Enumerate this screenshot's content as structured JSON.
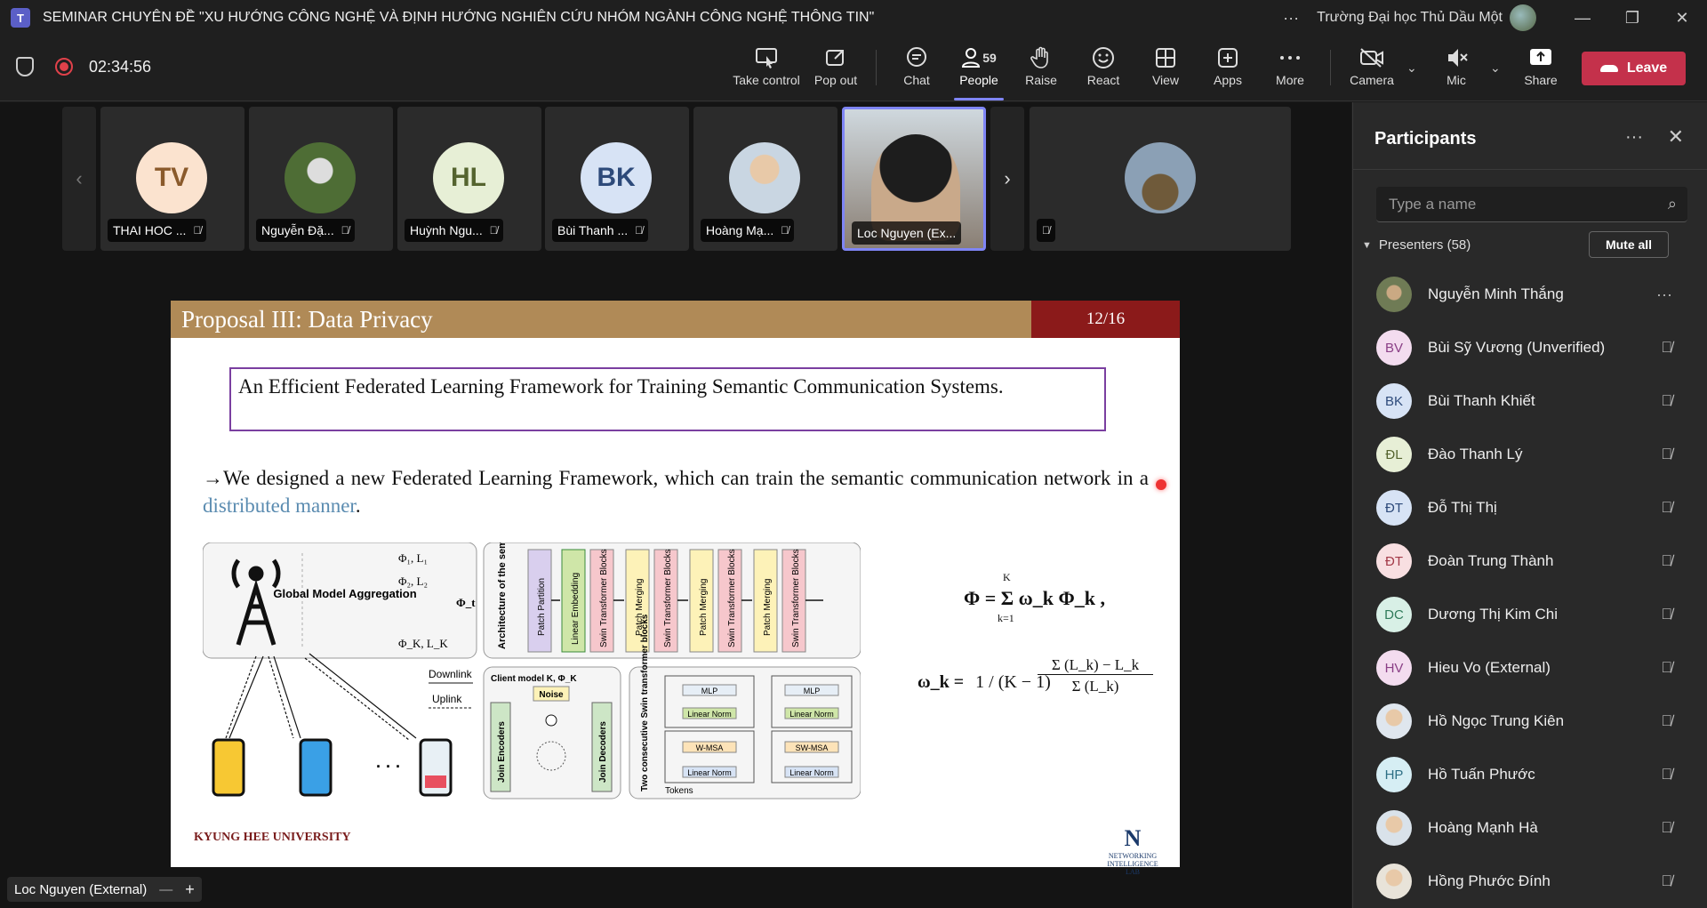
{
  "window": {
    "app_icon_letter": "T",
    "title": "SEMINAR CHUYÊN ĐỀ \"XU HƯỚNG CÔNG NGHỆ VÀ ĐỊNH HƯỚNG NGHIÊN CỨU NHÓM NGÀNH CÔNG NGHỆ THÔNG TIN\"",
    "more": "···",
    "org": "Trường Đại học Thủ Dầu Một",
    "minimize": "—",
    "restore": "❐",
    "close": "✕"
  },
  "toolbar": {
    "timer": "02:34:56",
    "take_control": "Take control",
    "pop_out": "Pop out",
    "chat": "Chat",
    "people": "People",
    "people_count": "59",
    "raise": "Raise",
    "react": "React",
    "view": "View",
    "apps": "Apps",
    "more": "More",
    "camera": "Camera",
    "mic": "Mic",
    "share": "Share",
    "leave": "Leave"
  },
  "strip": {
    "prev": "‹",
    "next": "›",
    "tiles": [
      {
        "initials": "TV",
        "name": "THAI HOC ...",
        "bg": "#fbe3cf",
        "fg": "#8a5a2b"
      },
      {
        "initials": "",
        "name": "Nguyễn Đặ...",
        "bg": "#6d8a4a",
        "fg": "#fff"
      },
      {
        "initials": "HL",
        "name": "Huỳnh Ngu...",
        "bg": "#e7efd6",
        "fg": "#55642f"
      },
      {
        "initials": "BK",
        "name": "Bùi Thanh ...",
        "bg": "#d7e3f5",
        "fg": "#2d4a7a"
      },
      {
        "initials": "",
        "name": "Hoàng Mạ...",
        "bg": "#d9e2ea",
        "fg": "#333"
      },
      {
        "initials": "",
        "name": "Loc Nguyen (Ex...",
        "bg": "#d6dde3",
        "fg": "#333"
      },
      {
        "initials": "",
        "name": "",
        "bg": "#8c7a5a",
        "fg": "#fff"
      }
    ]
  },
  "slide": {
    "title": "Proposal III: Data Privacy",
    "page": "12/16",
    "boxed_text": "An Efficient Federated Learning Framework for Training Semantic Communication Systems.",
    "bullet_prefix": "→We designed a new Federated Learning Framework, which can train the semantic communication network in a ",
    "bullet_highlight": "distributed manner",
    "bullet_suffix": ".",
    "fig": {
      "global": "Global Model Aggregation",
      "phi1": "Φ₁, L₁",
      "phi2": "Φ₂, L₂",
      "phiK": "Φ_K, L_K",
      "phit": "Φ_t",
      "downlink": "Downlink",
      "uplink": "Uplink",
      "arch": "Architecture of the semantic encoder",
      "patch_partition": "Patch Partition",
      "linear_embedding": "Linear Embedding",
      "swin": "Swin Transformer Blocks",
      "patch_merging": "Patch Merging",
      "client_model": "Client model K, Φ_K",
      "noise": "Noise",
      "join_enc": "Join Encoders",
      "join_dec": "Join Decoders",
      "two_consec": "Two consecutive Swin transformer blocks",
      "mlp": "MLP",
      "linear_norm": "Linear Norm",
      "wmsa": "W-MSA",
      "swmsa": "SW-MSA",
      "tokens": "Tokens",
      "ellipsis": "· · ·"
    },
    "formula1": "Φ = Σ ω_k Φ_k ,",
    "formula1_top": "K",
    "formula1_bot": "k=1",
    "formula2_lhs": "ω_k =",
    "formula2_frac1": "1 / (K − 1)",
    "formula2_num": "Σ (L_k) − L_k",
    "formula2_den": "Σ (L_k)",
    "logo_left": "KYUNG HEE UNIVERSITY",
    "logo_right": "NETWORKING INTELLIGENCE LAB"
  },
  "presenter": {
    "name": "Loc Nguyen (External)",
    "minus": "—",
    "plus": "+"
  },
  "panel": {
    "title": "Participants",
    "more": "···",
    "close": "✕",
    "search_placeholder": "Type a name",
    "section": "Presenters (58)",
    "mute_all": "Mute all",
    "participants": [
      {
        "initials": "",
        "name": "Nguyễn Minh Thắng",
        "bg": "#6f7b55",
        "fg": "#fff",
        "icon": "···"
      },
      {
        "initials": "BV",
        "name": "Bùi Sỹ Vương (Unverified)",
        "bg": "#f3dcef",
        "fg": "#8a3f86",
        "icon": "🎙̸"
      },
      {
        "initials": "BK",
        "name": "Bùi Thanh Khiết",
        "bg": "#d7e3f5",
        "fg": "#2d4a7a",
        "icon": "🎙̸"
      },
      {
        "initials": "ĐL",
        "name": "Đào Thanh Lý",
        "bg": "#e7efd6",
        "fg": "#55642f",
        "icon": "🎙̸"
      },
      {
        "initials": "ĐT",
        "name": "Đỗ Thị Thị",
        "bg": "#d7e3f5",
        "fg": "#2d4a7a",
        "icon": "🎙̸"
      },
      {
        "initials": "ĐT",
        "name": "Đoàn Trung Thành",
        "bg": "#f8dfe1",
        "fg": "#a33a48",
        "icon": "🎙̸"
      },
      {
        "initials": "DC",
        "name": "Dương Thị Kim Chi",
        "bg": "#d8f0e6",
        "fg": "#2f7a5a",
        "icon": "🎙̸"
      },
      {
        "initials": "HV",
        "name": "Hieu Vo (External)",
        "bg": "#f3dcef",
        "fg": "#8a3f86",
        "icon": "🎙̸"
      },
      {
        "initials": "",
        "name": "Hồ Ngọc Trung Kiên",
        "bg": "#dfe6ee",
        "fg": "#333",
        "icon": "🎙̸"
      },
      {
        "initials": "HP",
        "name": "Hồ Tuấn Phước",
        "bg": "#d6eef4",
        "fg": "#2d6f85",
        "icon": "🎙̸"
      },
      {
        "initials": "",
        "name": "Hoàng Mạnh Hà",
        "bg": "#d9e2ea",
        "fg": "#333",
        "icon": "🎙̸"
      },
      {
        "initials": "",
        "name": "Hồng Phước Đính",
        "bg": "#e8e3d9",
        "fg": "#333",
        "icon": "🎙̸"
      }
    ]
  }
}
